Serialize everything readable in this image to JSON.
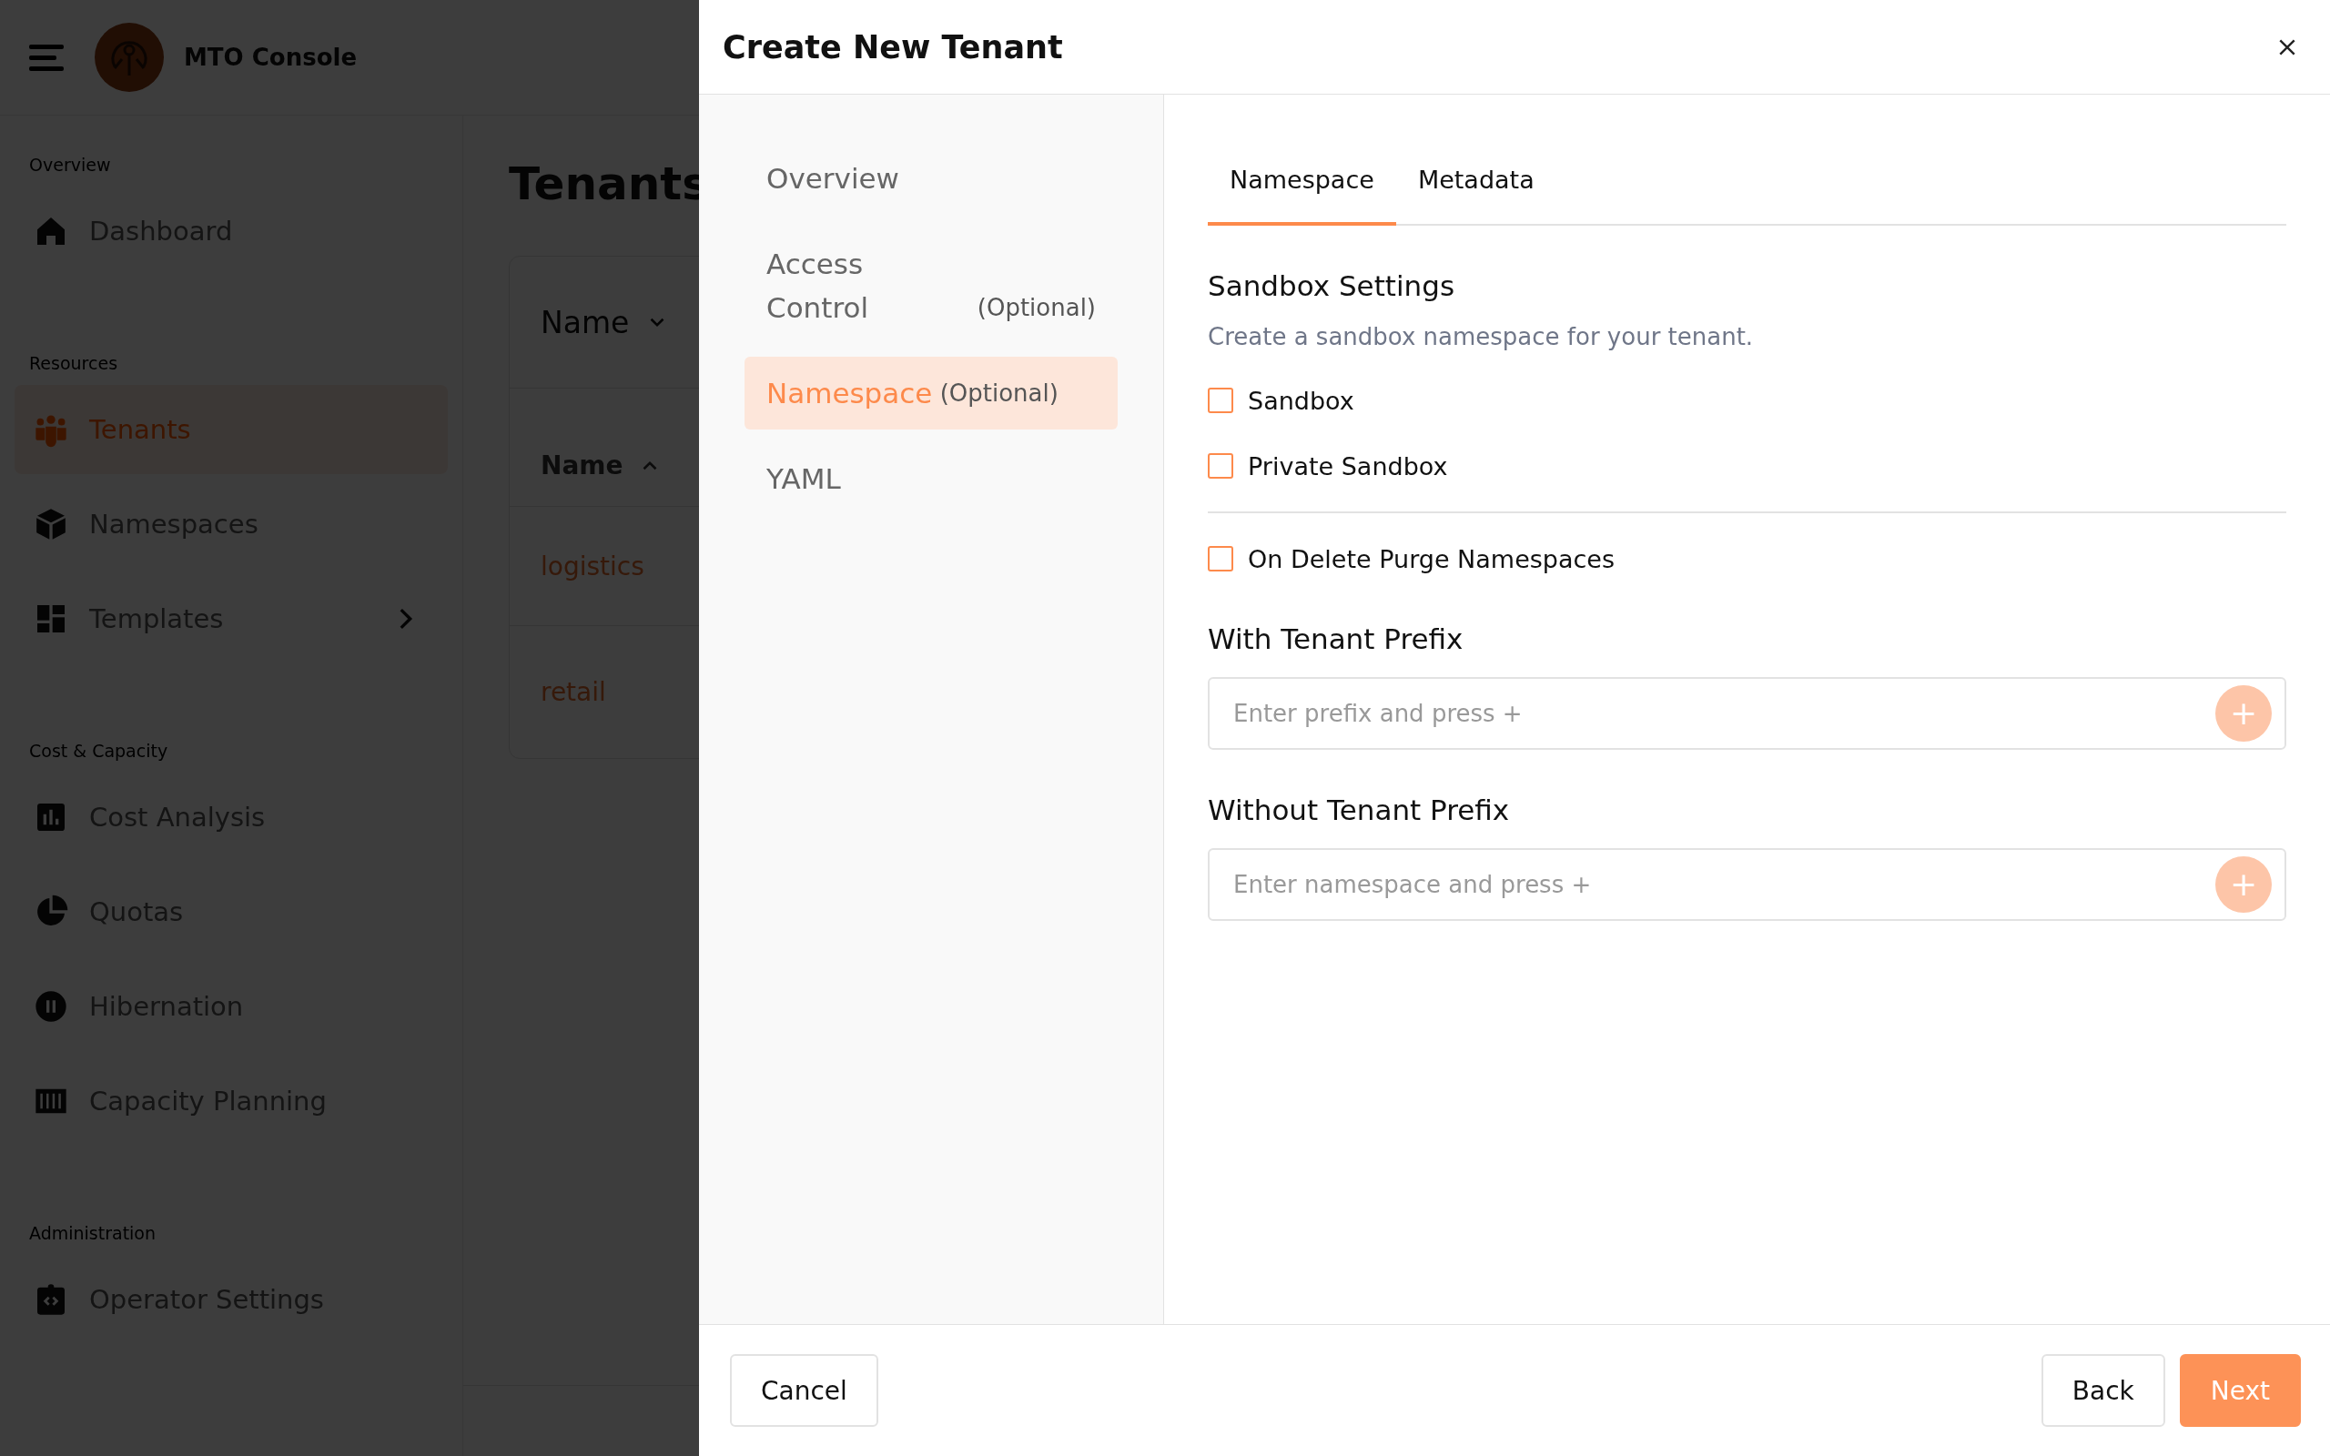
{
  "app": {
    "title": "MTO Console"
  },
  "sidebar": {
    "sections": [
      {
        "label": "Overview",
        "items": [
          {
            "label": "Dashboard",
            "selected": false,
            "expandable": false
          }
        ]
      },
      {
        "label": "Resources",
        "items": [
          {
            "label": "Tenants",
            "selected": true,
            "expandable": false
          },
          {
            "label": "Namespaces",
            "selected": false,
            "expandable": false
          },
          {
            "label": "Templates",
            "selected": false,
            "expandable": true
          }
        ]
      },
      {
        "label": "Cost & Capacity",
        "items": [
          {
            "label": "Cost Analysis",
            "selected": false,
            "expandable": false
          },
          {
            "label": "Quotas",
            "selected": false,
            "expandable": false
          },
          {
            "label": "Hibernation",
            "selected": false,
            "expandable": false
          },
          {
            "label": "Capacity Planning",
            "selected": false,
            "expandable": false
          }
        ]
      },
      {
        "label": "Administration",
        "items": [
          {
            "label": "Operator Settings",
            "selected": false,
            "expandable": false
          }
        ]
      }
    ]
  },
  "page": {
    "title": "Tenants",
    "filter": {
      "label": "Name"
    },
    "table": {
      "columns": [
        {
          "label": "Name",
          "ascending": true
        }
      ],
      "rows": [
        {
          "name": "logistics"
        },
        {
          "name": "retail"
        }
      ]
    }
  },
  "dialog": {
    "title": "Create New Tenant",
    "steps": [
      {
        "label": "Overview",
        "selected": false
      },
      {
        "label": "Access Control",
        "note": "(Optional)",
        "selected": false
      },
      {
        "label": "Namespace",
        "note": "(Optional)",
        "selected": true
      },
      {
        "label": "YAML",
        "selected": false
      }
    ],
    "tabs": [
      {
        "label": "Namespace",
        "selected": true
      },
      {
        "label": "Metadata",
        "selected": false
      }
    ],
    "blocks": [
      {
        "kind": "heading",
        "text": "Sandbox Settings"
      },
      {
        "kind": "text",
        "text": "Create a sandbox namespace for your tenant."
      },
      {
        "kind": "checkbox",
        "text": "Sandbox",
        "checked": false
      },
      {
        "kind": "checkbox",
        "text": "Private Sandbox",
        "checked": false
      },
      {
        "kind": "divider"
      },
      {
        "kind": "checkbox",
        "text": "On Delete Purge Namespaces",
        "checked": false
      },
      {
        "kind": "heading",
        "text": "With Tenant Prefix"
      },
      {
        "kind": "tag-input",
        "placeholder": "Enter prefix and press +",
        "button": "+"
      },
      {
        "kind": "heading",
        "text": "Without Tenant Prefix"
      },
      {
        "kind": "tag-input",
        "placeholder": "Enter namespace and press +",
        "button": "+"
      }
    ],
    "buttons": [
      {
        "label": "Cancel",
        "kind": "secondary"
      },
      {
        "label": "Back",
        "kind": "secondary"
      },
      {
        "label": "Next",
        "kind": "primary"
      }
    ]
  }
}
